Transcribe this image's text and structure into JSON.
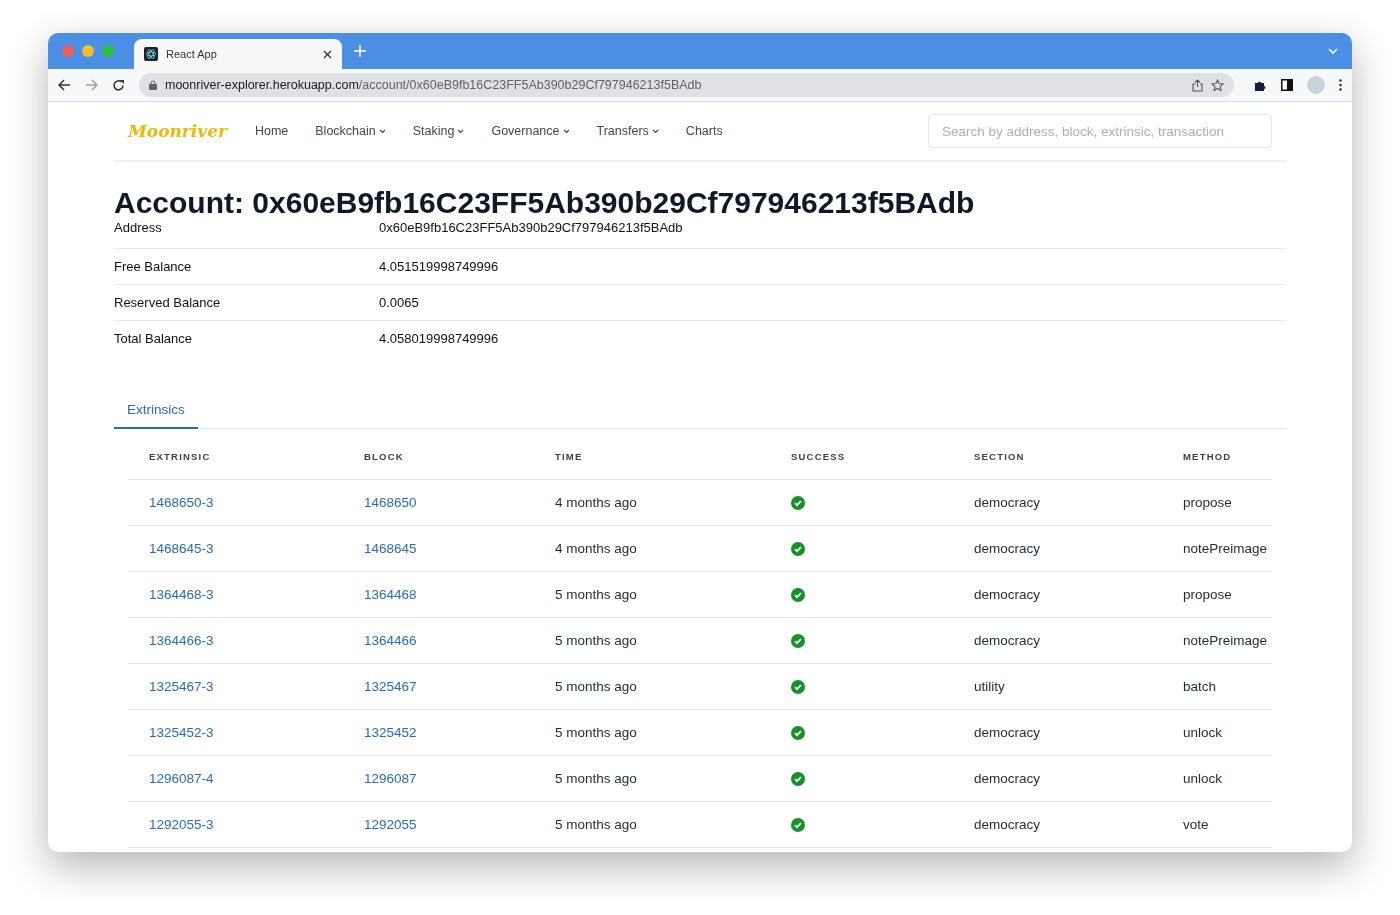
{
  "browser": {
    "tab_title": "React App",
    "url_host": "moonriver-explorer.herokuapp.com",
    "url_path": "/account/0x60eB9fb16C23FF5Ab390b29Cf797946213f5BAdb"
  },
  "nav": {
    "logo": "Moonriver",
    "items": [
      {
        "label": "Home",
        "dropdown": false
      },
      {
        "label": "Blockchain",
        "dropdown": true
      },
      {
        "label": "Staking",
        "dropdown": true
      },
      {
        "label": "Governance",
        "dropdown": true
      },
      {
        "label": "Transfers",
        "dropdown": true
      },
      {
        "label": "Charts",
        "dropdown": false
      }
    ],
    "search": {
      "placeholder": "Search by address, block, extrinsic, transaction"
    }
  },
  "title": "Account: 0x60eB9fb16C23FF5Ab390b29Cf797946213f5BAdb",
  "details": [
    {
      "label": "Address",
      "value": "0x60eB9fb16C23FF5Ab390b29Cf797946213f5BAdb"
    },
    {
      "label": "Free Balance",
      "value": "4.051519998749996"
    },
    {
      "label": "Reserved Balance",
      "value": "0.0065"
    },
    {
      "label": "Total Balance",
      "value": "4.058019998749996"
    }
  ],
  "tabs": [
    {
      "label": "Extrinsics",
      "selected": true
    }
  ],
  "table": {
    "columns": [
      "EXTRINSIC",
      "BLOCK",
      "TIME",
      "SUCCESS",
      "SECTION",
      "METHOD"
    ],
    "rows": [
      {
        "extrinsic": "1468650-3",
        "block": "1468650",
        "time": "4 months ago",
        "success": true,
        "section": "democracy",
        "method": "propose"
      },
      {
        "extrinsic": "1468645-3",
        "block": "1468645",
        "time": "4 months ago",
        "success": true,
        "section": "democracy",
        "method": "notePreimage"
      },
      {
        "extrinsic": "1364468-3",
        "block": "1364468",
        "time": "5 months ago",
        "success": true,
        "section": "democracy",
        "method": "propose"
      },
      {
        "extrinsic": "1364466-3",
        "block": "1364466",
        "time": "5 months ago",
        "success": true,
        "section": "democracy",
        "method": "notePreimage"
      },
      {
        "extrinsic": "1325467-3",
        "block": "1325467",
        "time": "5 months ago",
        "success": true,
        "section": "utility",
        "method": "batch"
      },
      {
        "extrinsic": "1325452-3",
        "block": "1325452",
        "time": "5 months ago",
        "success": true,
        "section": "democracy",
        "method": "unlock"
      },
      {
        "extrinsic": "1296087-4",
        "block": "1296087",
        "time": "5 months ago",
        "success": true,
        "section": "democracy",
        "method": "unlock"
      },
      {
        "extrinsic": "1292055-3",
        "block": "1292055",
        "time": "5 months ago",
        "success": true,
        "section": "democracy",
        "method": "vote"
      }
    ]
  }
}
